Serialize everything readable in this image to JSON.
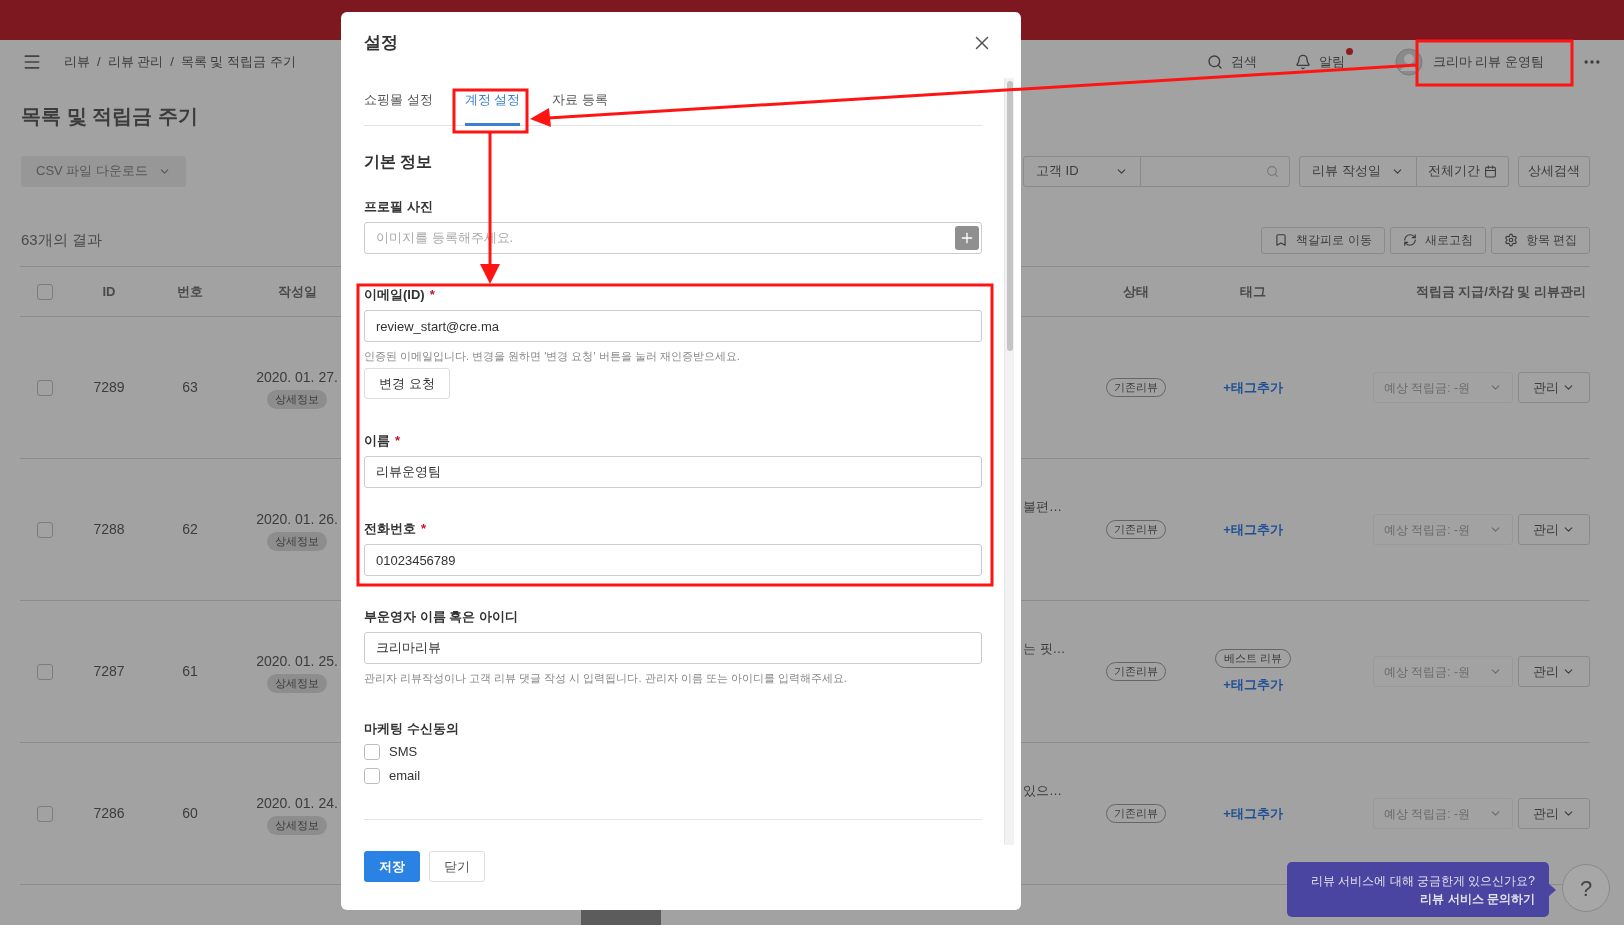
{
  "breadcrumb": {
    "separator": "/",
    "items": [
      "리뷰",
      "리뷰 관리",
      "목록 및 적립금 주기"
    ]
  },
  "header_actions": [
    {
      "kind": "search",
      "label": "검색"
    },
    {
      "kind": "notifications",
      "label": "알림",
      "badge": true
    }
  ],
  "user": {
    "name": "크리마 리뷰 운영팀"
  },
  "page_title": "목록 및 적립금 주기",
  "csv_button": {
    "label": "CSV 파일 다운로드",
    "disabled": true
  },
  "filters": {
    "field_select": "고객 ID",
    "date_select": "리뷰 작성일",
    "period": "전체기간",
    "detail_button": "상세검색"
  },
  "result_count": "63개의 결과",
  "toolbar": [
    {
      "kind": "bookmark",
      "label": "책갈피로 이동"
    },
    {
      "kind": "refresh",
      "label": "새로고침"
    },
    {
      "kind": "settings",
      "label": "항목 편집"
    }
  ],
  "table": {
    "select_all_checked": false,
    "columns": [
      "ID",
      "번호",
      "작성일",
      "상태",
      "태그",
      "적립금 지급/차감 및 리뷰관리"
    ],
    "rows": [
      {
        "checked": false,
        "id": "7289",
        "number": "63",
        "date": "2020. 01. 27.",
        "detail": "상세정보",
        "status": "기존리뷰",
        "tags": [],
        "add_tag": "+태그추가",
        "points": "예상 적립금: -원",
        "manage": "관리"
      },
      {
        "checked": false,
        "id": "7288",
        "number": "62",
        "date": "2020. 01. 26.",
        "detail": "상세정보",
        "content": "불편…",
        "status": "기존리뷰",
        "tags": [],
        "add_tag": "+태그추가",
        "points": "예상 적립금: -원",
        "manage": "관리"
      },
      {
        "checked": false,
        "id": "7287",
        "number": "61",
        "date": "2020. 01. 25.",
        "detail": "상세정보",
        "content": "는 핏…",
        "status": "기존리뷰",
        "tags": [
          "베스트 리뷰"
        ],
        "add_tag": "+태그추가",
        "points": "예상 적립금: -원",
        "manage": "관리"
      },
      {
        "checked": false,
        "id": "7286",
        "number": "60",
        "date": "2020. 01. 24.",
        "detail": "상세정보",
        "content": "있으…",
        "status": "기존리뷰",
        "tags": [],
        "add_tag": "+태그추가",
        "points": "예상 적립금: -원",
        "manage": "관리"
      }
    ]
  },
  "help": {
    "question": "리뷰 서비스에 대해 궁금한게 있으신가요?",
    "link": "리뷰 서비스 문의하기",
    "button": "?"
  },
  "modal": {
    "title": "설정",
    "required_mark": "*",
    "tabs": [
      {
        "label": "쇼핑몰 설정",
        "selected": false
      },
      {
        "label": "계정 설정",
        "selected": true
      },
      {
        "label": "자료 등록",
        "selected": false
      }
    ],
    "section": "기본 정보",
    "fields": [
      {
        "kind": "image",
        "label": "프로필 사진",
        "required": false,
        "placeholder": "이미지를 등록해주세요."
      },
      {
        "kind": "text",
        "label": "이메일(ID)",
        "required": true,
        "value": "review_start@cre.ma",
        "help": "인증된 이메일입니다. 변경을 원하면 '변경 요청' 버튼을 눌러 재인증받으세요.",
        "action": "변경 요청"
      },
      {
        "kind": "text",
        "label": "이름",
        "required": true,
        "value": "리뷰운영팀"
      },
      {
        "kind": "text",
        "label": "전화번호",
        "required": true,
        "value": "01023456789"
      },
      {
        "kind": "text",
        "label": "부운영자 이름 혹은 아이디",
        "required": false,
        "value": "크리마리뷰",
        "help": "관리자 리뷰작성이나 고객 리뷰 댓글 작성 시 입력됩니다. 관리자 이름 또는 아이디를 입력해주세요."
      }
    ],
    "marketing": {
      "label": "마케팅 수신동의",
      "options": [
        {
          "label": "SMS",
          "checked": false
        },
        {
          "label": "email",
          "checked": false
        }
      ]
    },
    "buttons": [
      {
        "kind": "primary",
        "label": "저장"
      },
      {
        "kind": "default",
        "label": "닫기"
      }
    ]
  }
}
